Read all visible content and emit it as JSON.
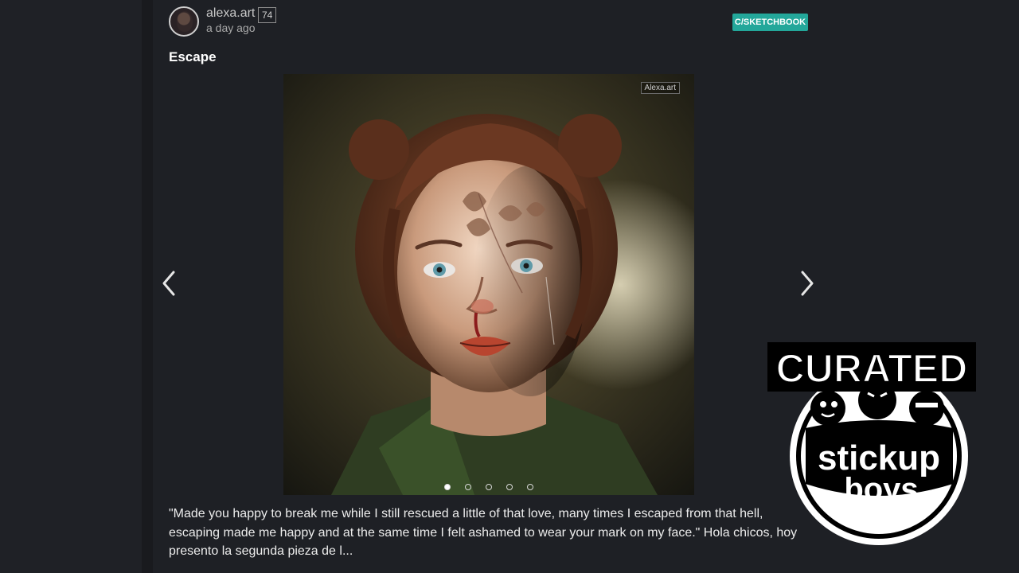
{
  "post": {
    "author": "alexa.art",
    "reputation": "74",
    "time": "a day ago",
    "community": "C/SKETCHBOOK",
    "title": "Escape",
    "image_watermark": "Alexa.art",
    "carousel": {
      "total": 5,
      "current": 1
    },
    "body": "\"Made you happy to break me while I still rescued a little of that love, many times I escaped from that hell, escaping made me happy and at the same time I felt ashamed to wear your mark on my face.\" Hola chicos, hoy presento la segunda pieza de l..."
  },
  "badge": {
    "top_text": "CURATED",
    "line1": "stickup",
    "line2": "boys"
  },
  "icons": {
    "prev": "chevron-left-icon",
    "next": "chevron-right-icon"
  },
  "colors": {
    "background": "#1e2025",
    "community_badge": "#23a79a"
  }
}
